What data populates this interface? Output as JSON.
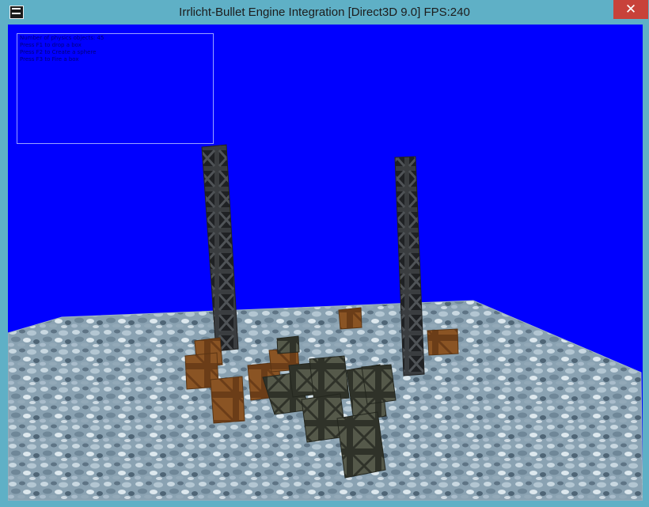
{
  "window": {
    "title": "Irrlicht-Bullet Engine Integration [Direct3D 9.0] FPS:240",
    "close_glyph": "✕"
  },
  "viewport": {
    "background_color": "#0000ff"
  },
  "info_panel": {
    "lines": [
      "Number of physics objects: 45",
      "Press F1 to drop a box",
      "Press F2 to Create a sphere",
      "Press F3 to Fire a box"
    ]
  },
  "icons": {
    "app": "irrlicht-logo-icon",
    "close": "close-icon"
  }
}
